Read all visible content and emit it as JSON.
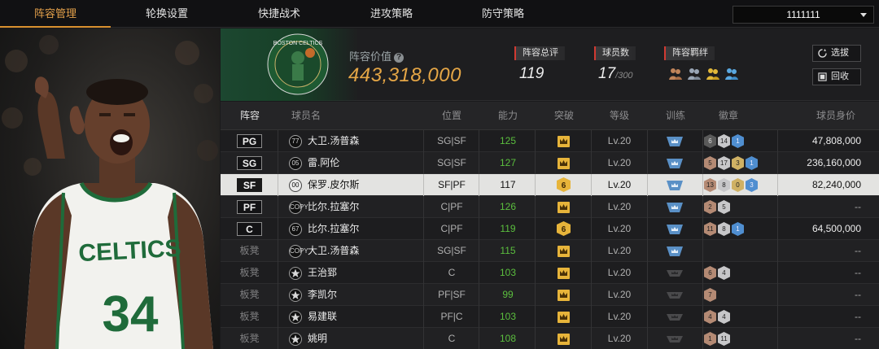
{
  "nav": {
    "tabs": [
      {
        "label": "阵容管理",
        "active": true
      },
      {
        "label": "轮换设置",
        "active": false
      },
      {
        "label": "快捷战术",
        "active": false
      },
      {
        "label": "进攻策略",
        "active": false
      },
      {
        "label": "防守策略",
        "active": false
      }
    ],
    "account_dropdown": "1111111"
  },
  "team": {
    "logo_text": "BOSTON CELTICS",
    "value_label": "阵容价值",
    "value": "443,318,000"
  },
  "stats": {
    "overall_label": "阵容总评",
    "overall_value": "119",
    "player_count_label": "球员数",
    "player_count": "17",
    "player_count_max": "/300",
    "bond_label": "阵容羁绊"
  },
  "buttons": {
    "pick": "选拔",
    "recycle": "回收"
  },
  "table": {
    "headers": [
      "阵容",
      "球员名",
      "位置",
      "能力",
      "突破",
      "等级",
      "训练",
      "徽章",
      "球员身价"
    ],
    "rows": [
      {
        "slot": "PG",
        "icon": "77",
        "name": "大卫.汤普森",
        "pos": "SG|SF",
        "rating": "125",
        "breakthrough": "crown",
        "level": "Lv.20",
        "train": "blue",
        "badges": [
          {
            "t": "drk",
            "v": "6"
          },
          {
            "t": "slv",
            "v": "14"
          },
          {
            "t": "blu",
            "v": "1"
          }
        ],
        "worth": "47,808,000"
      },
      {
        "slot": "SG",
        "icon": "05",
        "name": "雷.阿伦",
        "pos": "SG|SF",
        "rating": "127",
        "breakthrough": "crown",
        "level": "Lv.20",
        "train": "blue",
        "badges": [
          {
            "t": "brz",
            "v": "5"
          },
          {
            "t": "slv",
            "v": "17"
          },
          {
            "t": "gld",
            "v": "3"
          },
          {
            "t": "blu",
            "v": "1"
          }
        ],
        "worth": "236,160,000"
      },
      {
        "slot": "SF",
        "icon": "00",
        "name": "保罗.皮尔斯",
        "pos": "SF|PF",
        "rating": "117",
        "breakthrough": "6",
        "level": "Lv.20",
        "train": "blue",
        "badges": [
          {
            "t": "brz",
            "v": "13"
          },
          {
            "t": "slv",
            "v": "8"
          },
          {
            "t": "gld",
            "v": "0"
          },
          {
            "t": "blu",
            "v": "3"
          }
        ],
        "worth": "82,240,000",
        "selected": true
      },
      {
        "slot": "PF",
        "icon": "COPY",
        "name": "比尔.拉塞尔",
        "pos": "C|PF",
        "rating": "126",
        "breakthrough": "crown",
        "level": "Lv.20",
        "train": "blue",
        "badges": [
          {
            "t": "brz",
            "v": "2"
          },
          {
            "t": "slv",
            "v": "5"
          }
        ],
        "worth": "--"
      },
      {
        "slot": "C",
        "icon": "67",
        "name": "比尔.拉塞尔",
        "pos": "C|PF",
        "rating": "119",
        "breakthrough": "6",
        "level": "Lv.20",
        "train": "blue",
        "badges": [
          {
            "t": "brz",
            "v": "11"
          },
          {
            "t": "slv",
            "v": "8"
          },
          {
            "t": "blu",
            "v": "1"
          }
        ],
        "worth": "64,500,000"
      },
      {
        "slot": "板凳",
        "icon": "COPY",
        "name": "大卫.汤普森",
        "pos": "SG|SF",
        "rating": "115",
        "breakthrough": "crown",
        "level": "Lv.20",
        "train": "blue",
        "badges": [],
        "worth": "--"
      },
      {
        "slot": "板凳",
        "icon": "star",
        "name": "王治郅",
        "pos": "C",
        "rating": "103",
        "breakthrough": "crown",
        "level": "Lv.20",
        "train": "grey",
        "badges": [
          {
            "t": "brz",
            "v": "6"
          },
          {
            "t": "slv",
            "v": "4"
          }
        ],
        "worth": "--"
      },
      {
        "slot": "板凳",
        "icon": "star",
        "name": "李凯尔",
        "pos": "PF|SF",
        "rating": "99",
        "breakthrough": "crown",
        "level": "Lv.20",
        "train": "grey",
        "badges": [
          {
            "t": "brz",
            "v": "7"
          }
        ],
        "worth": "--"
      },
      {
        "slot": "板凳",
        "icon": "star",
        "name": "易建联",
        "pos": "PF|C",
        "rating": "103",
        "breakthrough": "crown",
        "level": "Lv.20",
        "train": "grey",
        "badges": [
          {
            "t": "brz",
            "v": "4"
          },
          {
            "t": "slv",
            "v": "4"
          }
        ],
        "worth": "--"
      },
      {
        "slot": "板凳",
        "icon": "star",
        "name": "姚明",
        "pos": "C",
        "rating": "108",
        "breakthrough": "crown",
        "level": "Lv.20",
        "train": "grey",
        "badges": [
          {
            "t": "brz",
            "v": "1"
          },
          {
            "t": "slv",
            "v": "11"
          }
        ],
        "worth": "--"
      }
    ]
  },
  "portrait": {
    "jersey_text": "CELTICS",
    "jersey_number": "34"
  },
  "colors": {
    "accent": "#e3a04a",
    "rating_green": "#5bbf3e",
    "bond_red": "#d13a32",
    "selected_row": "#e3e3e1"
  }
}
